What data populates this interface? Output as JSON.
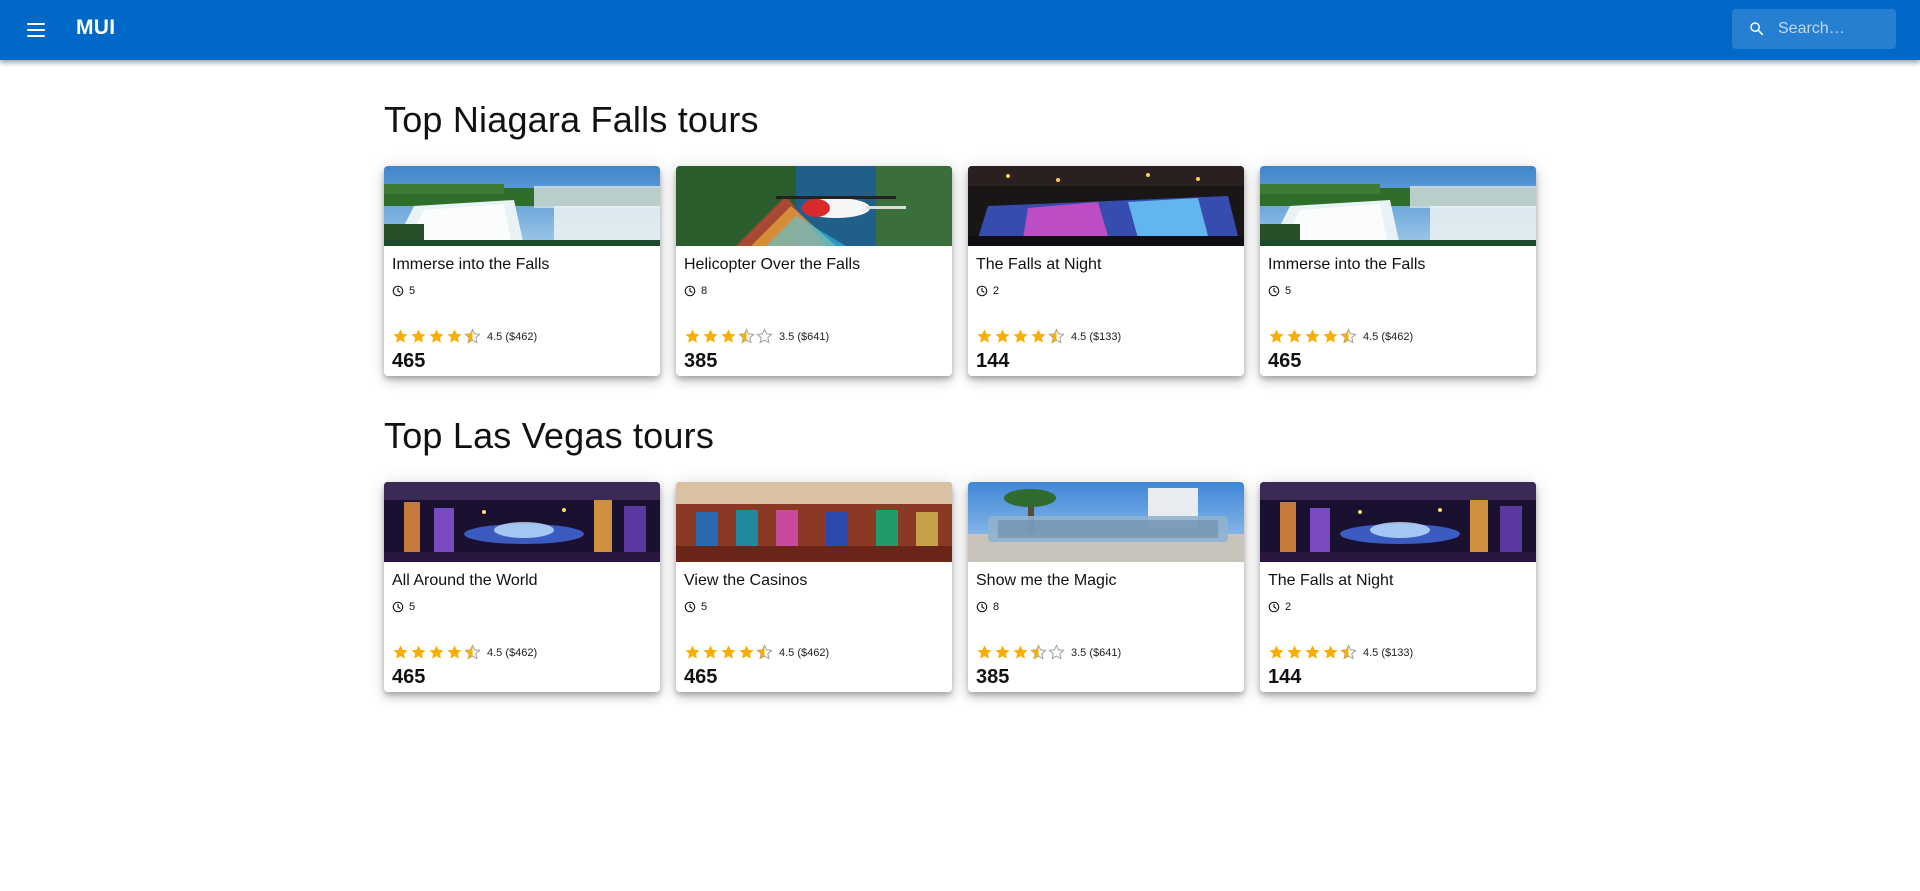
{
  "app": {
    "brand": "MUI",
    "search_placeholder": "Search…",
    "menu_icon": "menu-icon",
    "search_icon": "search-icon",
    "appbar_color": "#0069c8"
  },
  "sections": [
    {
      "title": "Top Niagara Falls tours",
      "cards": [
        {
          "title": "Immerse into the Falls",
          "image": "niagara-falls-photo",
          "duration": "5",
          "rating": 4.5,
          "rating_text": "4.5 ($462)",
          "price": "465"
        },
        {
          "title": "Helicopter Over the Falls",
          "image": "helicopter-photo",
          "duration": "8",
          "rating": 3.5,
          "rating_text": "3.5 ($641)",
          "price": "385"
        },
        {
          "title": "The Falls at Night",
          "image": "falls-night-photo",
          "duration": "2",
          "rating": 4.5,
          "rating_text": "4.5 ($133)",
          "price": "144"
        },
        {
          "title": "Immerse into the Falls",
          "image": "niagara-falls-photo",
          "duration": "5",
          "rating": 4.5,
          "rating_text": "4.5 ($462)",
          "price": "465"
        }
      ]
    },
    {
      "title": "Top Las Vegas tours",
      "cards": [
        {
          "title": "All Around the World",
          "image": "vegas-night-photo",
          "duration": "5",
          "rating": 4.5,
          "rating_text": "4.5 ($462)",
          "price": "465"
        },
        {
          "title": "View the Casinos",
          "image": "casino-photo",
          "duration": "5",
          "rating": 4.5,
          "rating_text": "4.5 ($462)",
          "price": "465"
        },
        {
          "title": "Show me the Magic",
          "image": "magic-sign-photo",
          "duration": "8",
          "rating": 3.5,
          "rating_text": "3.5 ($641)",
          "price": "385"
        },
        {
          "title": "The Falls at Night",
          "image": "vegas-night-photo",
          "duration": "2",
          "rating": 4.5,
          "rating_text": "4.5 ($133)",
          "price": "144"
        }
      ]
    }
  ],
  "colors": {
    "star_filled": "#faaf00",
    "star_empty": "#9e9e9e"
  }
}
